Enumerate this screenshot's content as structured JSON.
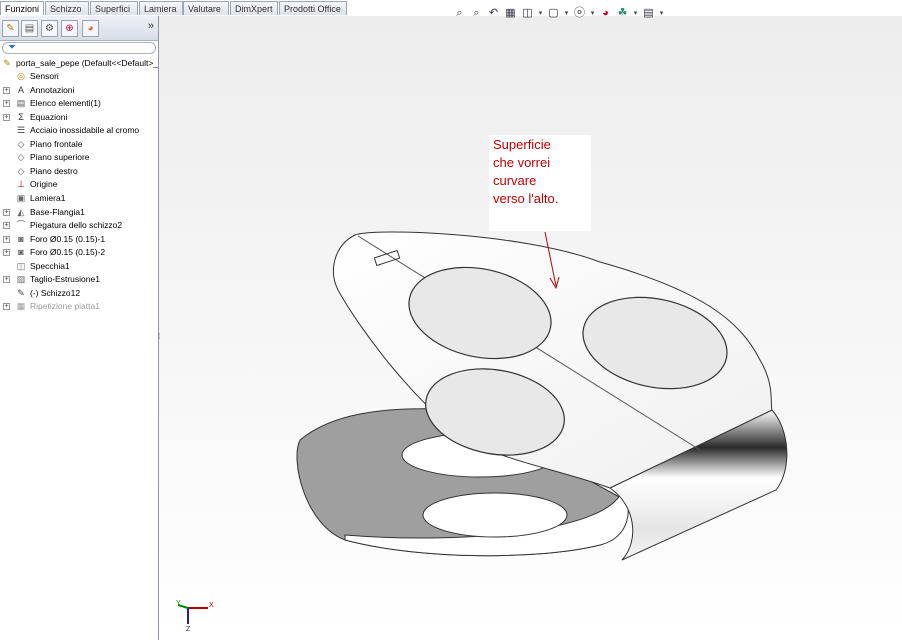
{
  "tabs": [
    {
      "label": "Funzioni",
      "active": true
    },
    {
      "label": "Schizzo",
      "active": false
    },
    {
      "label": "Superfici",
      "active": false
    },
    {
      "label": "Lamiera",
      "active": false
    },
    {
      "label": "Valutare",
      "active": false
    },
    {
      "label": "DimXpert",
      "active": false
    },
    {
      "label": "Prodotti Office",
      "active": false
    }
  ],
  "panel_tabs": {
    "icons": [
      "feature-manager-icon",
      "property-manager-icon",
      "configuration-manager-icon",
      "dimxpert-manager-icon",
      "display-manager-icon"
    ],
    "more": "»"
  },
  "tree": {
    "root": "porta_sale_pepe  (Default<<Default>_",
    "items": [
      {
        "label": "Sensori",
        "icon": "sensor-icon",
        "expander": false
      },
      {
        "label": "Annotazioni",
        "icon": "annotation-icon",
        "expander": true
      },
      {
        "label": "Elenco elementi(1)",
        "icon": "cut-list-icon",
        "expander": true
      },
      {
        "label": "Equazioni",
        "icon": "equation-icon",
        "expander": true
      },
      {
        "label": "Acciaio inossidabile al cromo",
        "icon": "material-icon",
        "expander": false
      },
      {
        "label": "Piano frontale",
        "icon": "plane-icon",
        "expander": false
      },
      {
        "label": "Piano superiore",
        "icon": "plane-icon",
        "expander": false
      },
      {
        "label": "Piano destro",
        "icon": "plane-icon",
        "expander": false
      },
      {
        "label": "Origine",
        "icon": "origin-icon",
        "expander": false
      },
      {
        "label": "Lamiera1",
        "icon": "sheet-metal-icon",
        "expander": false
      },
      {
        "label": "Base-Flangia1",
        "icon": "base-flange-icon",
        "expander": true
      },
      {
        "label": "Piegatura dello schizzo2",
        "icon": "sketched-bend-icon",
        "expander": true
      },
      {
        "label": "Foro Ø0.15 (0.15)-1",
        "icon": "hole-icon",
        "expander": true
      },
      {
        "label": "Foro Ø0.15 (0.15)-2",
        "icon": "hole-icon",
        "expander": true
      },
      {
        "label": "Specchia1",
        "icon": "mirror-icon",
        "expander": false
      },
      {
        "label": "Taglio-Estrusione1",
        "icon": "cut-extrude-icon",
        "expander": true
      },
      {
        "label": "(-) Schizzo12",
        "icon": "sketch-icon",
        "expander": false
      },
      {
        "label": "Ripetizione piatta1",
        "icon": "flat-pattern-icon",
        "expander": true,
        "dim": true
      }
    ]
  },
  "toolbar_icons": [
    "zoom-to-fit-icon",
    "zoom-area-icon",
    "previous-view-icon",
    "section-view-icon",
    "view-orientation-icon",
    "display-style-icon",
    "hide-show-icon",
    "edit-appearance-icon",
    "apply-scene-icon",
    "view-settings-icon"
  ],
  "annotation": {
    "lines": [
      "Superficie",
      "che vorrei",
      "curvare",
      "verso l'alto."
    ],
    "color": "#c00000"
  },
  "triad": {
    "x": "X",
    "y": "Y",
    "z": "Z"
  },
  "colors": {
    "tab_border": "#9aa7b8",
    "model_edge": "#3a3a3a",
    "model_face": "#ffffff",
    "model_shadow": "#9a9a9a"
  }
}
